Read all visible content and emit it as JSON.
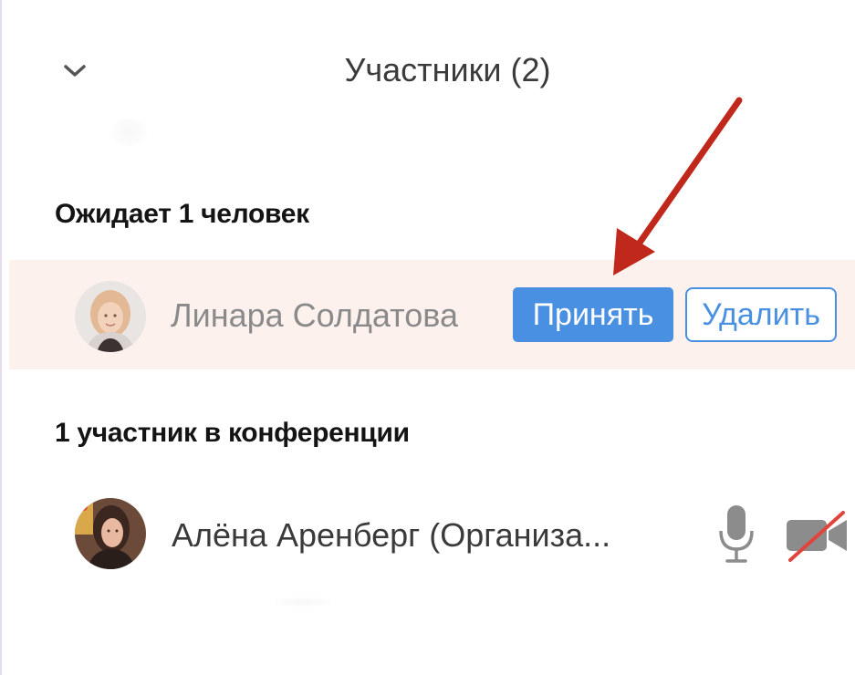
{
  "header": {
    "title": "Участники (2)",
    "collapse_icon": "chevron-down-icon"
  },
  "waiting": {
    "heading": "Ожидает 1 человек",
    "person": {
      "name": "Линара Солдатова",
      "accept_label": "Принять",
      "remove_label": "Удалить"
    }
  },
  "in_meeting": {
    "heading": "1 участник в конференции",
    "person": {
      "name": "Алёна Аренберг (Организа...",
      "mic_icon": "microphone-icon",
      "camera_icon": "video-camera-off-icon"
    }
  },
  "colors": {
    "accent": "#4a90e2",
    "waiting_row_bg": "#fdf1ee",
    "annotation_arrow": "#c0281c",
    "camera_off_slash": "#e0443c"
  }
}
